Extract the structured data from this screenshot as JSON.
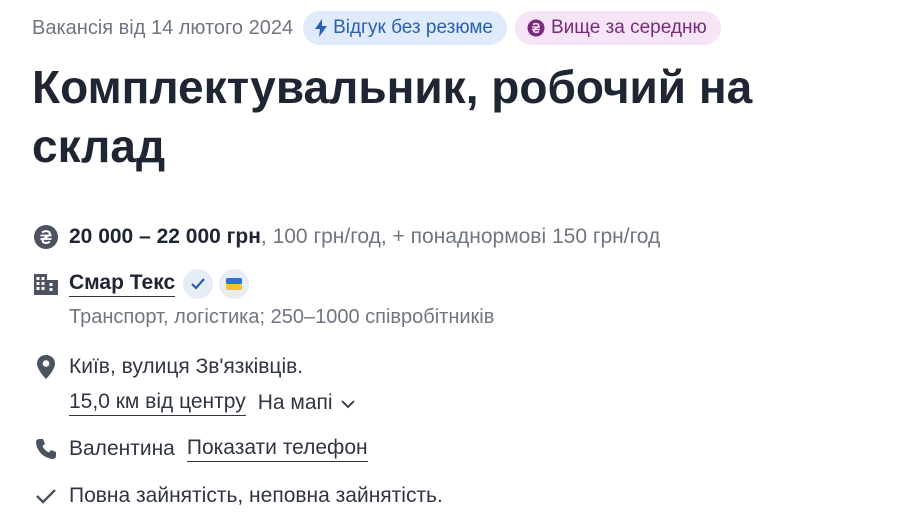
{
  "header": {
    "posted": "Вакансія від 14 лютого 2024",
    "badges": [
      {
        "label": "Відгук без резюме",
        "icon": "lightning-icon"
      },
      {
        "label": "Вище за середню",
        "icon": "hryvnia-coin-icon"
      }
    ]
  },
  "job": {
    "title": "Комплектувальник, робочий на склад"
  },
  "salary": {
    "range": "20 000 – 22 000 грн",
    "details": ", 100 грн/год, + понаднормові 150 грн/год",
    "icon": "hryvnia-icon"
  },
  "company": {
    "name": "Смар Текс",
    "verified_icon": "check-badge-icon",
    "flag_icon": "ukraine-flag-icon",
    "industry": "Транспорт, логістика; 250–1000 співробітників"
  },
  "location": {
    "address": "Київ, вулиця Зв'язківців.",
    "distance": "15,0 км від центру",
    "map_label": "На мапі"
  },
  "contact": {
    "name": "Валентина",
    "show_phone": "Показати телефон"
  },
  "employment": {
    "type": "Повна зайнятість, неповна зайнятість."
  },
  "colors": {
    "text": "#303641",
    "muted": "#6f7680",
    "badge_blue_bg": "#dfeafb",
    "badge_blue_text": "#2b5fb0",
    "badge_purple_bg": "#f6e4f7",
    "badge_purple_text": "#7a2a7e"
  }
}
